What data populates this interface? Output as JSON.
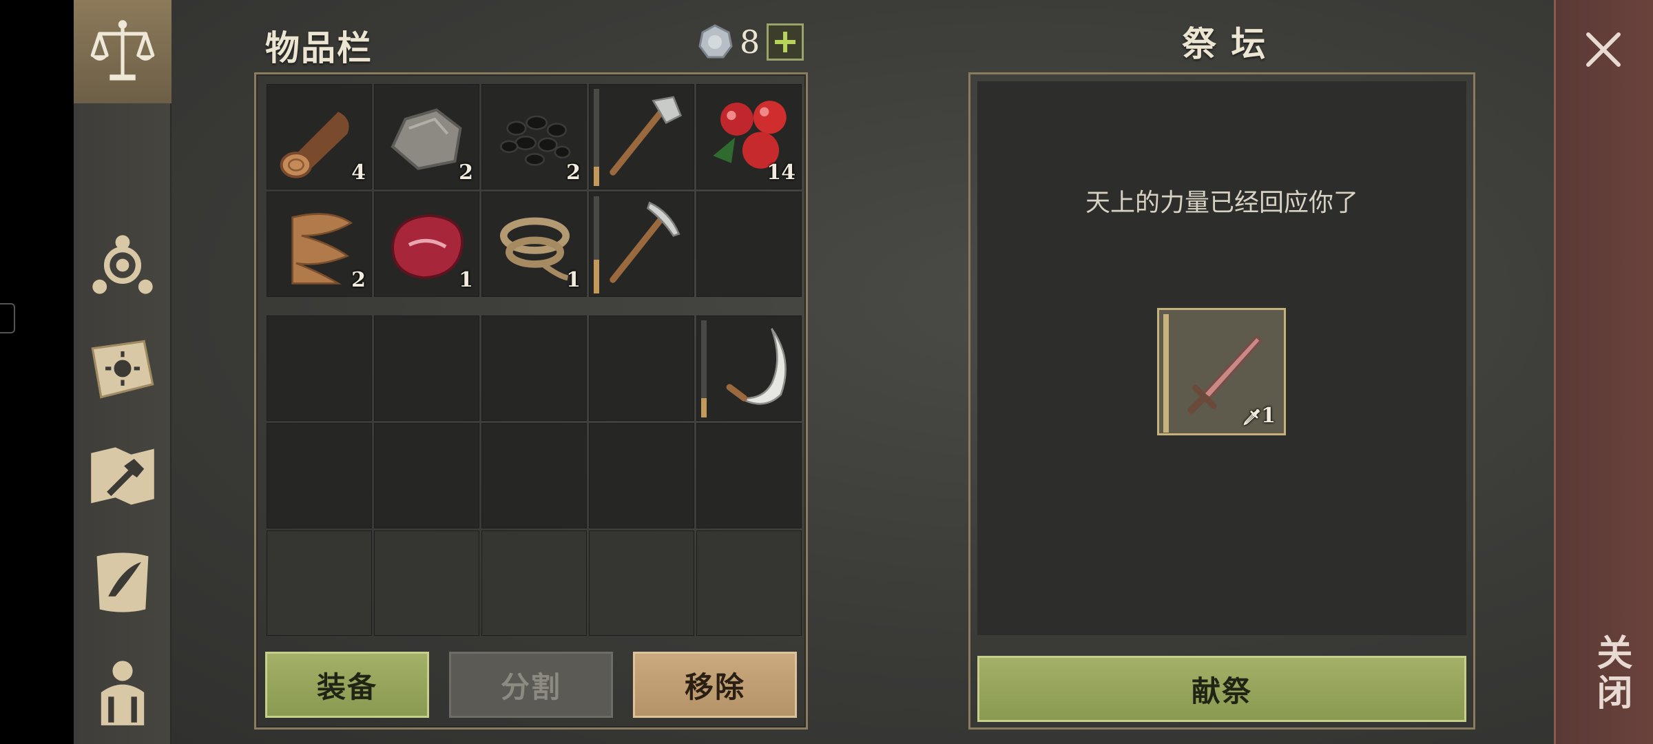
{
  "sidebar": {
    "tabs": [
      {
        "icon": "scales-icon",
        "active": true
      },
      {
        "icon": "clan-emblem-icon",
        "active": false
      },
      {
        "icon": "sun-book-icon",
        "active": false
      },
      {
        "icon": "crafting-hammer-icon",
        "active": false
      },
      {
        "icon": "quest-scroll-icon",
        "active": false
      },
      {
        "icon": "backpack-character-icon",
        "active": false
      }
    ]
  },
  "inventory": {
    "title": "物品栏",
    "coins": "8",
    "bag_slots": [
      {
        "item": "log",
        "count": "4"
      },
      {
        "item": "stone",
        "count": "2"
      },
      {
        "item": "coal",
        "count": "2"
      },
      {
        "item": "stone-hatchet",
        "count": "",
        "durability": 0.2
      },
      {
        "item": "berries",
        "count": "14"
      },
      {
        "item": "plant-fiber",
        "count": "2"
      },
      {
        "item": "raw-meat",
        "count": "1"
      },
      {
        "item": "rope",
        "count": "1"
      },
      {
        "item": "stone-pickaxe",
        "count": "",
        "durability": 0.35
      },
      {
        "item": "",
        "count": ""
      }
    ],
    "pocket_slots": [
      {
        "item": "",
        "count": ""
      },
      {
        "item": "",
        "count": ""
      },
      {
        "item": "",
        "count": ""
      },
      {
        "item": "",
        "count": ""
      },
      {
        "item": "sickle",
        "count": "",
        "durability": 0.2
      }
    ],
    "buttons": {
      "equip": "装备",
      "split": "分割",
      "remove": "移除"
    }
  },
  "altar": {
    "title": "祭 坛",
    "message": "天上的力量已经回应你了",
    "slot": {
      "item": "dagger",
      "count": "1"
    },
    "offer_button": "献祭"
  },
  "close": {
    "label": "关闭"
  },
  "colors": {
    "accent_green": "#a3b068",
    "frame_gold": "#8a7c5e",
    "close_red": "#6a423c"
  }
}
